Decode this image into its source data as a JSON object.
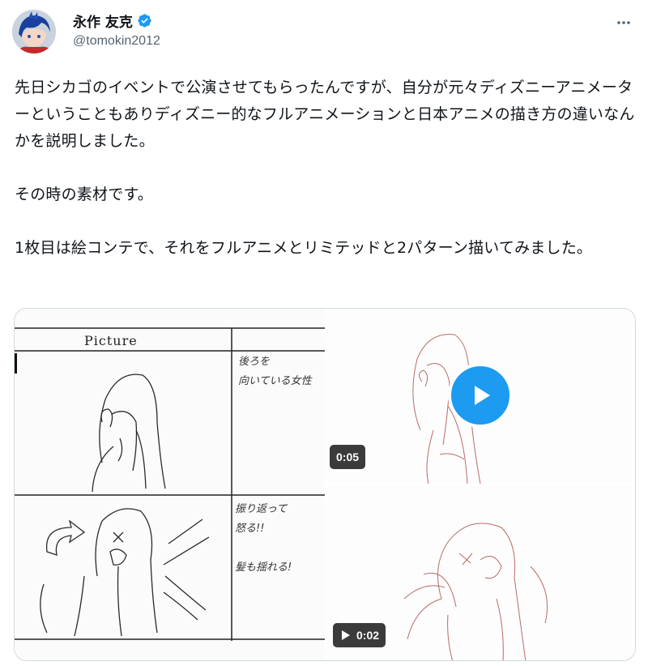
{
  "author": {
    "display_name": "永作 友克",
    "handle": "@tomokin2012",
    "verified": true,
    "accent_color": "#1d9bf0"
  },
  "tweet": {
    "text": "先日シカゴのイベントで公演させてもらったんですが、自分が元々ディズニーアニメーターということもありディズニー的なフルアニメーションと日本アニメの描き方の違いなんかを説明しました。\n\nその時の素材です。\n\n1枚目は絵コンテで、それをフルアニメとリミテッドと2パターン描いてみました。"
  },
  "media": {
    "storyboard": {
      "picture_header": "Picture",
      "note_1": "後ろを\n向いている女性",
      "note_2": "振り返って\n怒る!!\n\n髪も揺れる!"
    },
    "video_1": {
      "duration": "0:05"
    },
    "video_2": {
      "duration": "0:02"
    }
  },
  "icons": {
    "more": "more-horizontal-icon",
    "verified": "verified-badge-icon",
    "play": "play-icon"
  }
}
